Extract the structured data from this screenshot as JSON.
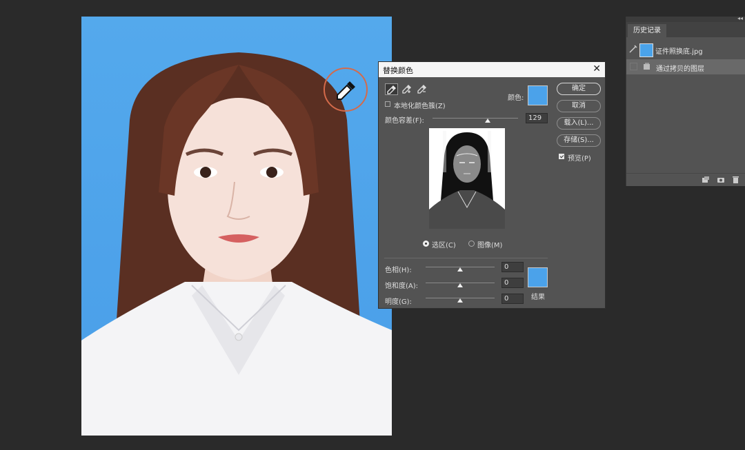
{
  "history_panel": {
    "tab_label": "历史记录",
    "snapshot_label": "证件照换底.jpg",
    "state_label": "通过拷贝的图层"
  },
  "dialog": {
    "title": "替换颜色",
    "color_label": "颜色:",
    "localized_label": "本地化颜色簇(Z)",
    "fuzziness_label": "颜色容差(F):",
    "fuzziness_value": "129",
    "ok_label": "确定",
    "cancel_label": "取消",
    "load_label": "载入(L)...",
    "save_label": "存储(S)...",
    "preview_label": "预览(P)",
    "selection_radio_label": "选区(C)",
    "image_radio_label": "图像(M)",
    "hue_label": "色相(H):",
    "hue_value": "0",
    "saturation_label": "饱和度(A):",
    "saturation_value": "0",
    "lightness_label": "明度(G):",
    "lightness_value": "0",
    "result_label": "结果",
    "sample_color": "#4ba2ea",
    "result_color": "#4ba2ea"
  }
}
